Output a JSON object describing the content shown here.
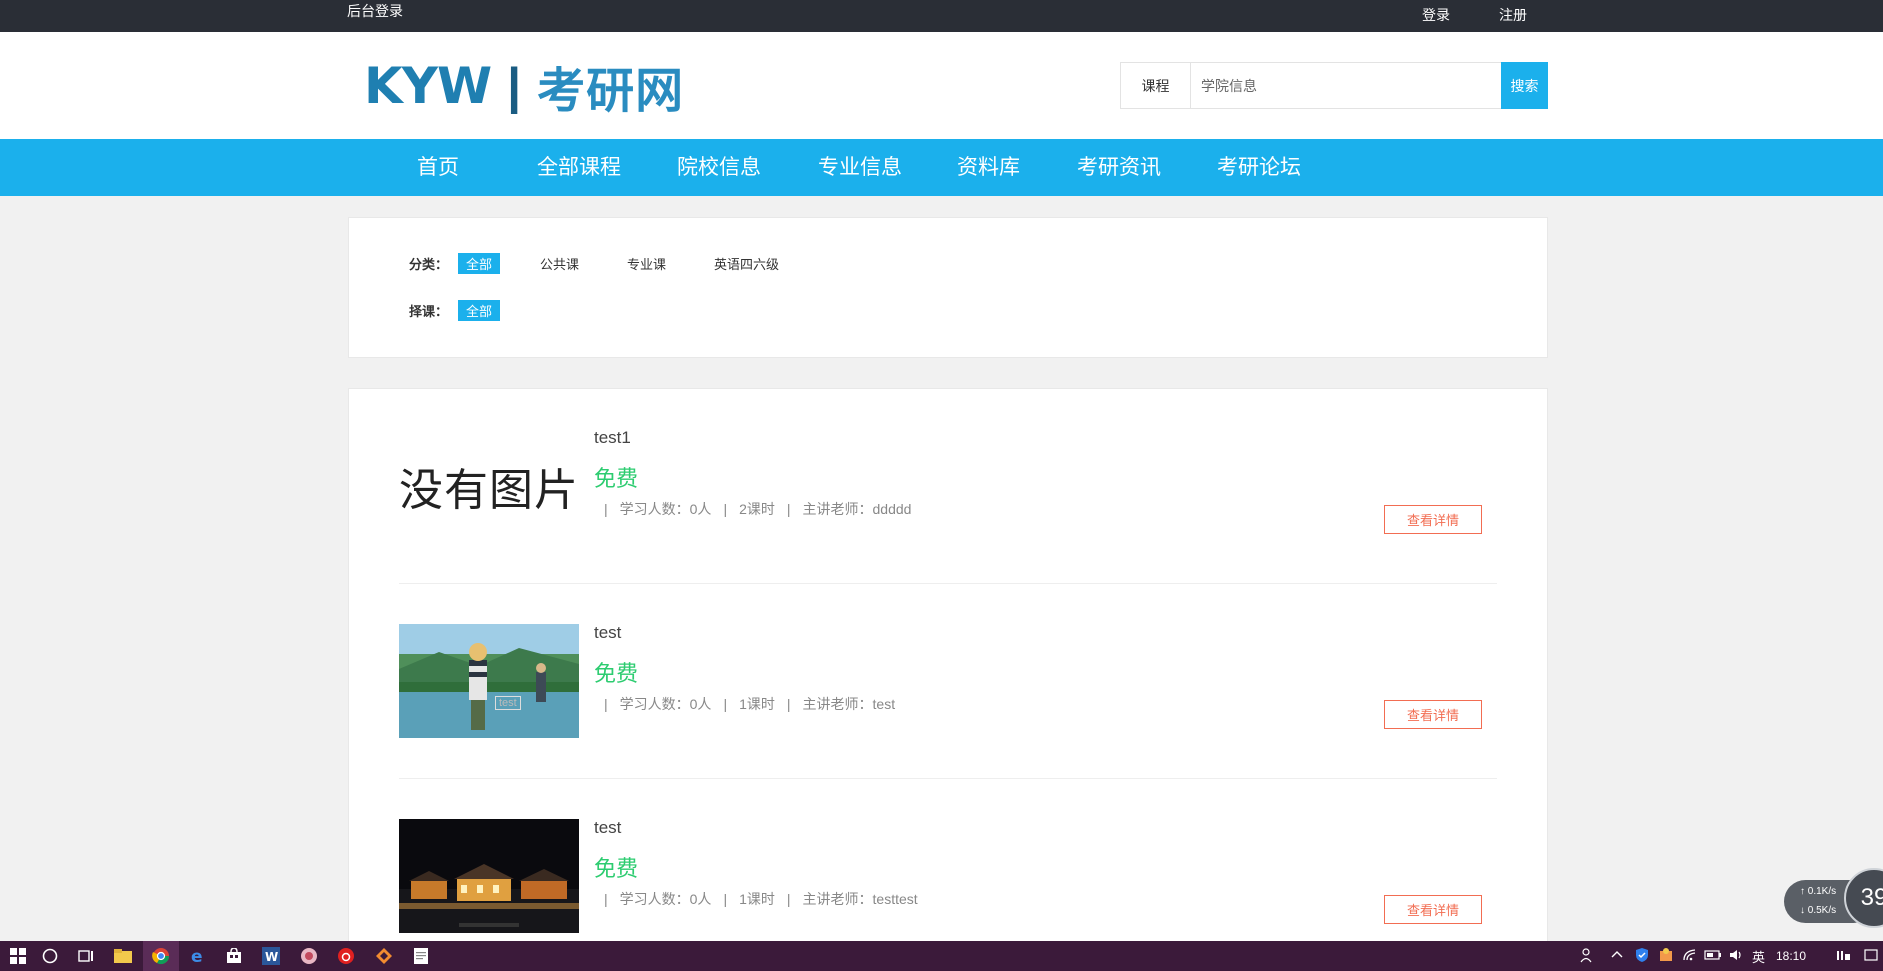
{
  "topbar": {
    "admin_login": "后台登录",
    "login": "登录",
    "register": "注册"
  },
  "header": {
    "logo_en": "KYW",
    "logo_sep": "|",
    "logo_cn": "考研网",
    "search": {
      "category": "课程",
      "placeholder": "学院信息",
      "button": "搜索"
    }
  },
  "nav": {
    "items": [
      {
        "label": "首页"
      },
      {
        "label": "全部课程"
      },
      {
        "label": "院校信息"
      },
      {
        "label": "专业信息"
      },
      {
        "label": "资料库"
      },
      {
        "label": "考研资讯"
      },
      {
        "label": "考研论坛"
      }
    ]
  },
  "filter": {
    "category_label": "分类：",
    "category_tags": [
      "全部",
      "公共课",
      "专业课",
      "英语四六级"
    ],
    "course_label": "择课：",
    "course_tags": [
      "全部"
    ]
  },
  "courses": [
    {
      "title": "test1",
      "price": "免费",
      "students": "学习人数：0人",
      "hours": "2课时",
      "teacher": "主讲老师：ddddd",
      "image_text": "没有图片",
      "image_caption": "",
      "detail": "查看详情"
    },
    {
      "title": "test",
      "price": "免费",
      "students": "学习人数：0人",
      "hours": "1课时",
      "teacher": "主讲老师：test",
      "image_text": "",
      "image_caption": "test",
      "detail": "查看详情"
    },
    {
      "title": "test",
      "price": "免费",
      "students": "学习人数：0人",
      "hours": "1课时",
      "teacher": "主讲老师：testtest",
      "image_text": "",
      "image_caption": "",
      "detail": "查看详情"
    }
  ],
  "meta_sep": "|",
  "taskbar": {
    "time": "18:10",
    "ime": "英"
  },
  "net_widget": {
    "up": "0.1K/s",
    "down": "0.5K/s",
    "percent": "39"
  },
  "colors": {
    "accent": "#1bb0ec",
    "price": "#2dcc70",
    "detail": "#f26d52",
    "topbar": "#2a2e36",
    "taskbar": "#3b1a3a"
  }
}
